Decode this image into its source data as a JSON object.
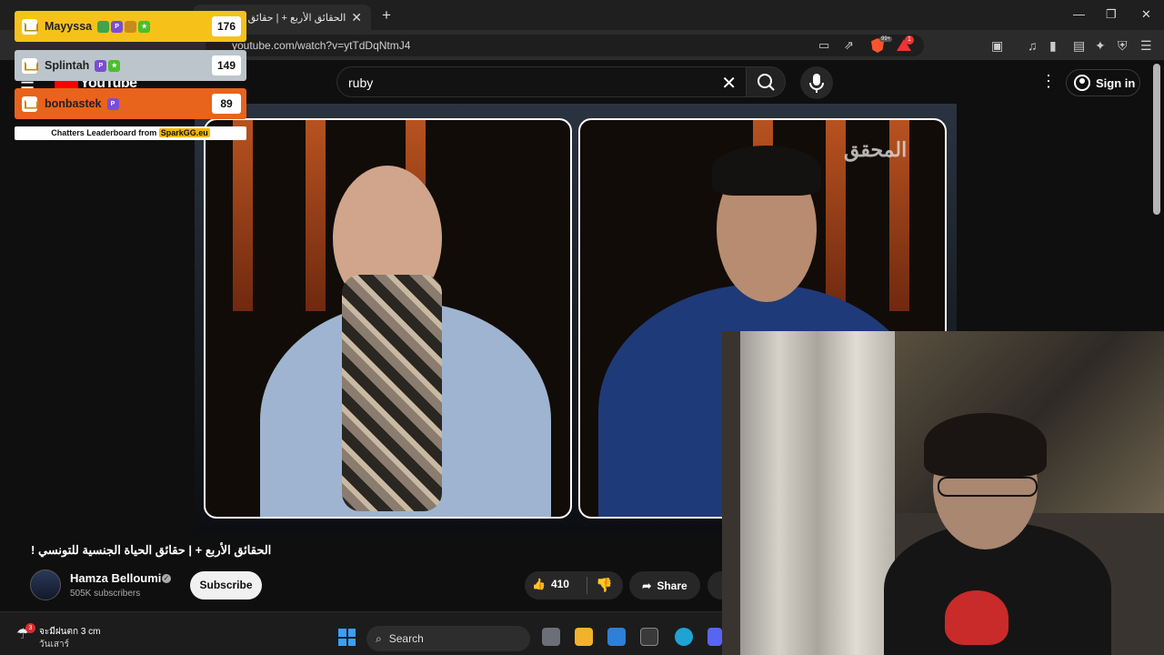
{
  "browser": {
    "tab_title": "الحقائق الأربع + | حقائق الحياة الجنسية للتونسي !",
    "url": "youtube.com/watch?v=ytTdDqNtmJ4",
    "brave_badge": "99+",
    "rewards_badge": "1"
  },
  "youtube": {
    "logo_text": "YouTube",
    "search_value": "ruby",
    "sign_in_label": "Sign in"
  },
  "video": {
    "title": "الحقائق الأربع + | حقائق الحياة الجنسية للتونسي !",
    "channel_name": "Hamza Belloumi",
    "subscribers": "505K subscribers",
    "subscribe_label": "Subscribe",
    "like_count": "410",
    "share_label": "Share",
    "watermark": "المحقق"
  },
  "leaderboard": {
    "entries": [
      {
        "name": "Mayyssa",
        "score": "176",
        "color": "#f6c21a"
      },
      {
        "name": "Splintah",
        "score": "149",
        "color": "#bcc4cc"
      },
      {
        "name": "bonbastek",
        "score": "89",
        "color": "#e8631c"
      }
    ],
    "footer_text": "Chatters Leaderboard from",
    "footer_brand": "SparkGG.eu"
  },
  "taskbar": {
    "weather_line1": "จะมีฝนตก 3 cm",
    "weather_line2": "วันเสาร์",
    "weather_badge": "3",
    "search_label": "Search"
  }
}
